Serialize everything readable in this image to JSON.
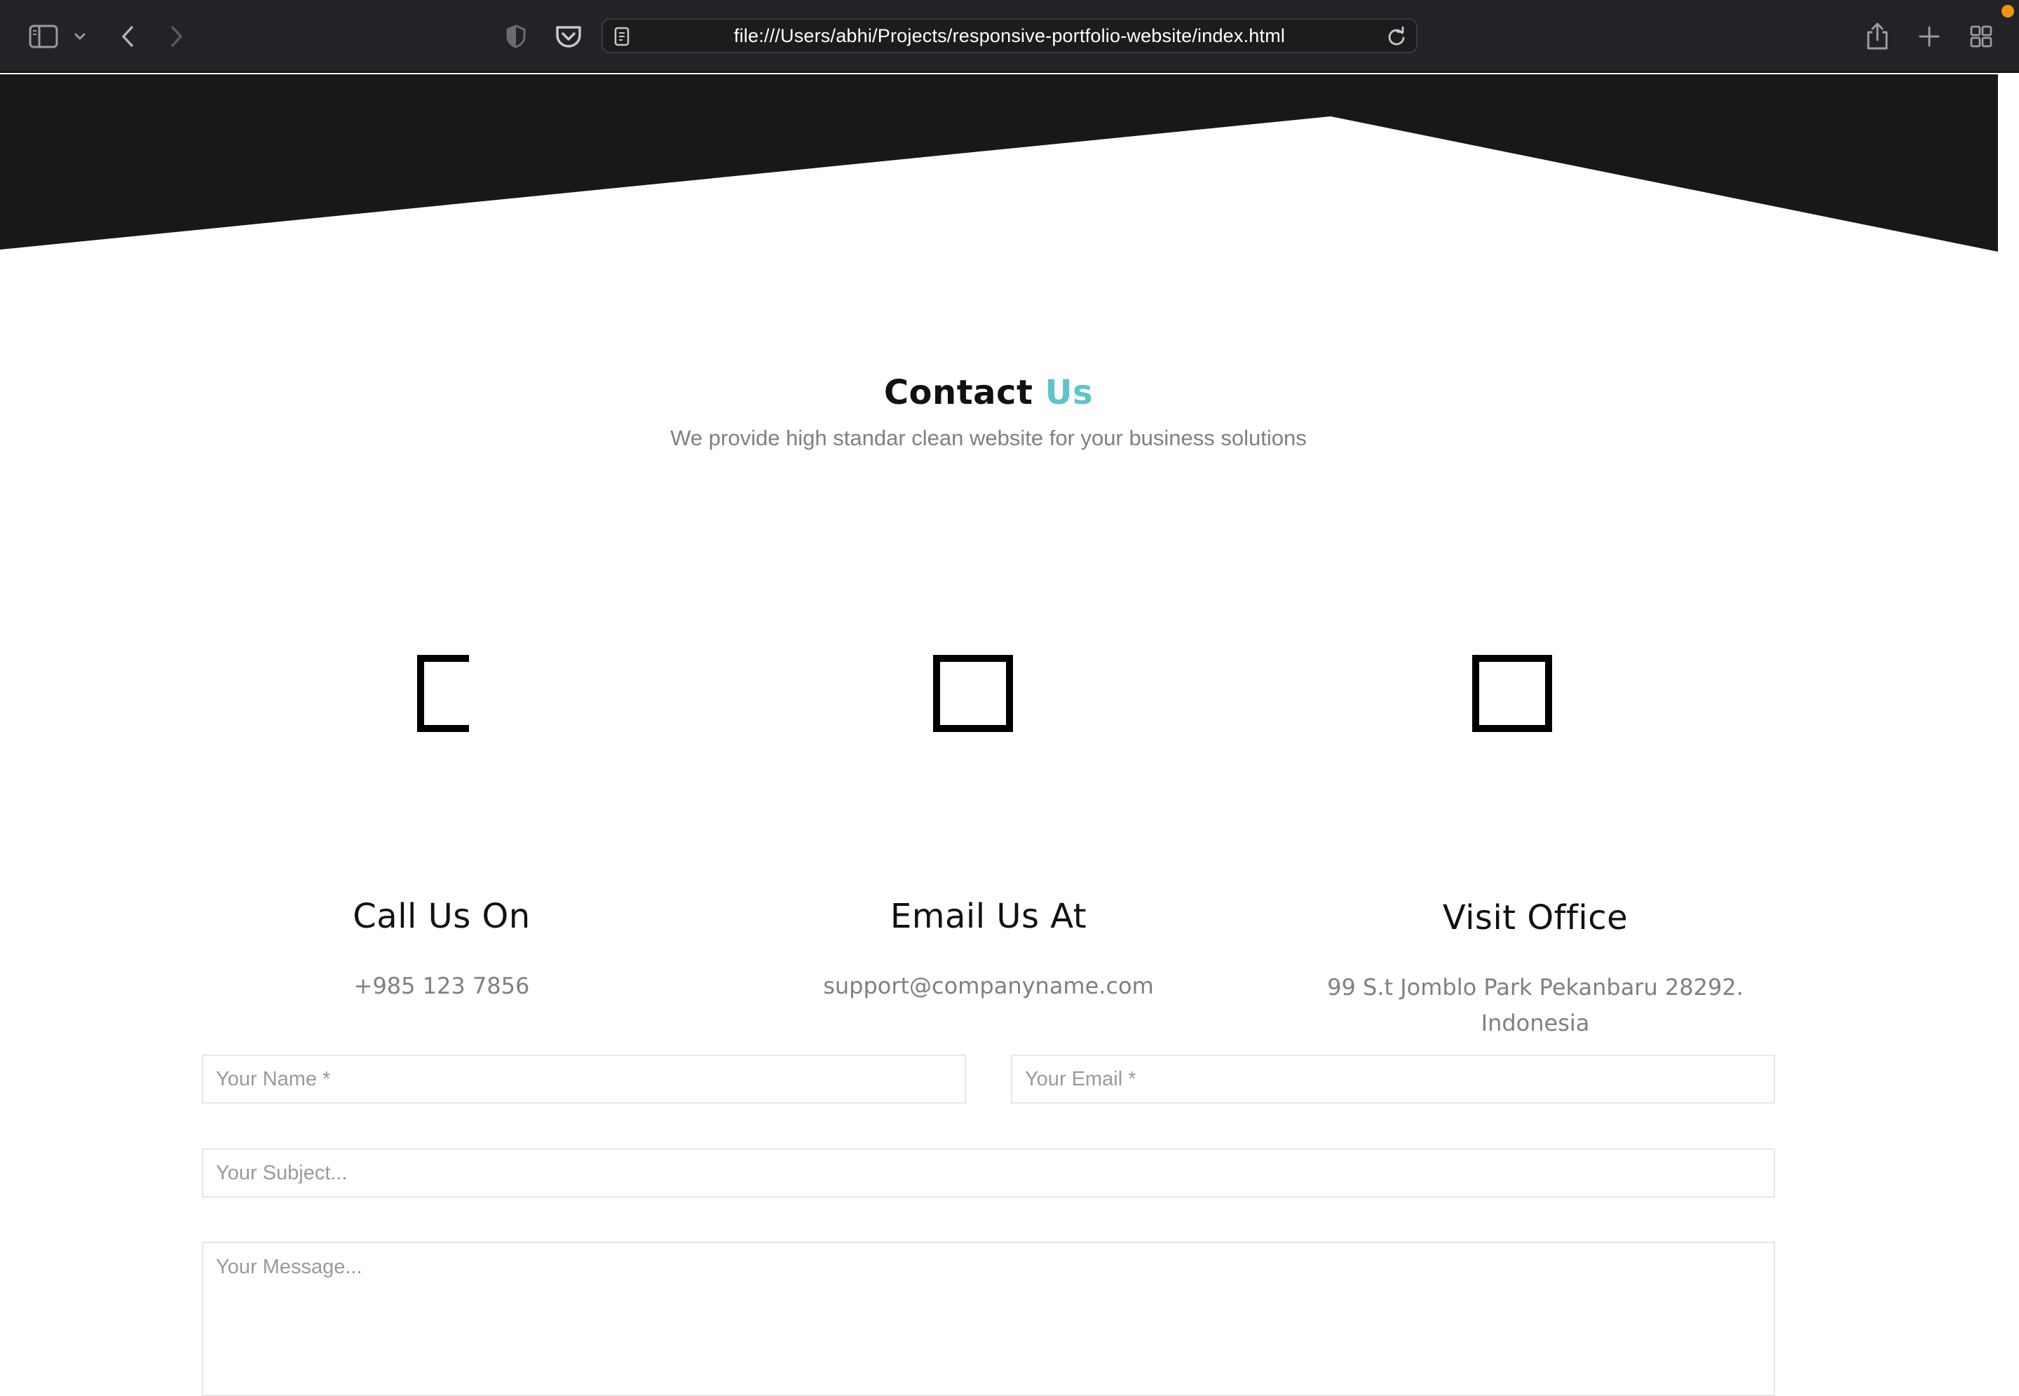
{
  "browser": {
    "url": "file:///Users/abhi/Projects/responsive-portfolio-website/index.html",
    "icons": [
      "sidebar-icon",
      "chevron-down-icon",
      "back-icon",
      "forward-icon",
      "shield-icon",
      "pocket-icon",
      "page-icon",
      "reload-icon",
      "share-icon",
      "new-tab-icon",
      "tab-overview-icon"
    ],
    "notification_color": "#f2920d"
  },
  "contact": {
    "title_main": "Contact",
    "title_accent": "Us",
    "accent_color": "#5ec4c9",
    "subtitle": "We provide high standar clean website for your business solutions",
    "cards": [
      {
        "title": "Call Us On",
        "value": "+985 123 7856",
        "icon": "phone-icon"
      },
      {
        "title": "Email Us At",
        "value": "support@companyname.com",
        "icon": "email-icon"
      },
      {
        "title": "Visit Office",
        "value": "99 S.t Jomblo Park Pekanbaru 28292. Indonesia",
        "icon": "location-icon"
      }
    ]
  },
  "form": {
    "name_placeholder": "Your Name *",
    "email_placeholder": "Your Email *",
    "subject_placeholder": "Your Subject...",
    "message_placeholder": "Your Message..."
  }
}
